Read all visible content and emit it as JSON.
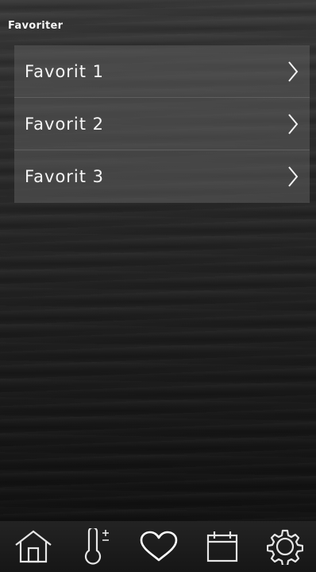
{
  "header": {
    "title": "Favoriter"
  },
  "favorites": [
    {
      "label": "Favorit 1",
      "icon": "chevron-right-icon"
    },
    {
      "label": "Favorit 2",
      "icon": "chevron-right-icon"
    },
    {
      "label": "Favorit 3",
      "icon": "chevron-right-icon"
    }
  ],
  "nav": {
    "items": [
      {
        "icon": "home-icon",
        "active": false
      },
      {
        "icon": "thermometer-icon",
        "active": false
      },
      {
        "icon": "heart-icon",
        "active": true
      },
      {
        "icon": "calendar-icon",
        "active": false
      },
      {
        "icon": "gear-icon",
        "active": false
      }
    ]
  },
  "colors": {
    "text": "#ffffff",
    "row_background": "#4a4a4a",
    "nav_icon": "#e6e6e6",
    "nav_icon_active": "#ffffff"
  }
}
